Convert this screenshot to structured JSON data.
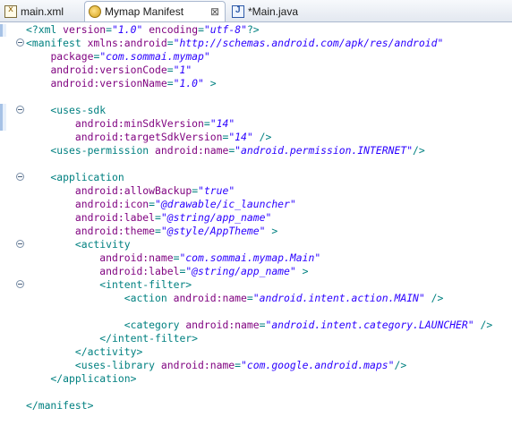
{
  "tabs": [
    {
      "label": "main.xml",
      "icon": "xml-file-icon",
      "active": false
    },
    {
      "label": "Mymap Manifest",
      "icon": "android-manifest-icon",
      "active": true,
      "close": "⊠"
    },
    {
      "label": "*Main.java",
      "icon": "java-file-icon",
      "active": false
    }
  ],
  "colors": {
    "tag": "#008080",
    "attribute": "#7f007f",
    "value": "#2a00ff"
  },
  "code_lines": [
    [
      [
        "p",
        "<?xml "
      ],
      [
        "a",
        "version"
      ],
      [
        "p",
        "="
      ],
      [
        "v",
        "\"1.0\""
      ],
      [
        "p",
        " "
      ],
      [
        "a",
        "encoding"
      ],
      [
        "p",
        "="
      ],
      [
        "v",
        "\"utf-8\""
      ],
      [
        "p",
        "?>"
      ]
    ],
    [
      [
        "p",
        "<manifest "
      ],
      [
        "a",
        "xmlns:android"
      ],
      [
        "p",
        "="
      ],
      [
        "v",
        "\"http://schemas.android.com/apk/res/android\""
      ]
    ],
    [
      [
        "p",
        "    "
      ],
      [
        "a",
        "package"
      ],
      [
        "p",
        "="
      ],
      [
        "v",
        "\"com.sommai.mymap\""
      ]
    ],
    [
      [
        "p",
        "    "
      ],
      [
        "a",
        "android:versionCode"
      ],
      [
        "p",
        "="
      ],
      [
        "v",
        "\"1\""
      ]
    ],
    [
      [
        "p",
        "    "
      ],
      [
        "a",
        "android:versionName"
      ],
      [
        "p",
        "="
      ],
      [
        "v",
        "\"1.0\""
      ],
      [
        "p",
        " >"
      ]
    ],
    [],
    [
      [
        "p",
        "    <uses-sdk"
      ]
    ],
    [
      [
        "p",
        "        "
      ],
      [
        "a",
        "android:minSdkVersion"
      ],
      [
        "p",
        "="
      ],
      [
        "v",
        "\"14\""
      ]
    ],
    [
      [
        "p",
        "        "
      ],
      [
        "a",
        "android:targetSdkVersion"
      ],
      [
        "p",
        "="
      ],
      [
        "v",
        "\"14\""
      ],
      [
        "p",
        " />"
      ]
    ],
    [
      [
        "p",
        "    <uses-permission "
      ],
      [
        "a",
        "android:name"
      ],
      [
        "p",
        "="
      ],
      [
        "v",
        "\"android.permission.INTERNET\""
      ],
      [
        "p",
        "/>"
      ]
    ],
    [],
    [
      [
        "p",
        "    <application"
      ]
    ],
    [
      [
        "p",
        "        "
      ],
      [
        "a",
        "android:allowBackup"
      ],
      [
        "p",
        "="
      ],
      [
        "v",
        "\"true\""
      ]
    ],
    [
      [
        "p",
        "        "
      ],
      [
        "a",
        "android:icon"
      ],
      [
        "p",
        "="
      ],
      [
        "v",
        "\"@drawable/ic_launcher\""
      ]
    ],
    [
      [
        "p",
        "        "
      ],
      [
        "a",
        "android:label"
      ],
      [
        "p",
        "="
      ],
      [
        "v",
        "\"@string/app_name\""
      ]
    ],
    [
      [
        "p",
        "        "
      ],
      [
        "a",
        "android:theme"
      ],
      [
        "p",
        "="
      ],
      [
        "v",
        "\"@style/AppTheme\""
      ],
      [
        "p",
        " >"
      ]
    ],
    [
      [
        "p",
        "        <activity"
      ]
    ],
    [
      [
        "p",
        "            "
      ],
      [
        "a",
        "android:name"
      ],
      [
        "p",
        "="
      ],
      [
        "v",
        "\"com.sommai.mymap.Main\""
      ]
    ],
    [
      [
        "p",
        "            "
      ],
      [
        "a",
        "android:label"
      ],
      [
        "p",
        "="
      ],
      [
        "v",
        "\"@string/app_name\""
      ],
      [
        "p",
        " >"
      ]
    ],
    [
      [
        "p",
        "            <intent-filter>"
      ]
    ],
    [
      [
        "p",
        "                <action "
      ],
      [
        "a",
        "android:name"
      ],
      [
        "p",
        "="
      ],
      [
        "v",
        "\"android.intent.action.MAIN\""
      ],
      [
        "p",
        " />"
      ]
    ],
    [],
    [
      [
        "p",
        "                <category "
      ],
      [
        "a",
        "android:name"
      ],
      [
        "p",
        "="
      ],
      [
        "v",
        "\"android.intent.category.LAUNCHER\""
      ],
      [
        "p",
        " />"
      ]
    ],
    [
      [
        "p",
        "            </intent-filter>"
      ]
    ],
    [
      [
        "p",
        "        </activity>"
      ]
    ],
    [
      [
        "p",
        "        <uses-library "
      ],
      [
        "a",
        "android:name"
      ],
      [
        "p",
        "="
      ],
      [
        "v",
        "\"com.google.android.maps\""
      ],
      [
        "p",
        "/>"
      ]
    ],
    [
      [
        "p",
        "    </application>"
      ]
    ],
    [],
    [
      [
        "p",
        "</manifest>"
      ]
    ]
  ]
}
